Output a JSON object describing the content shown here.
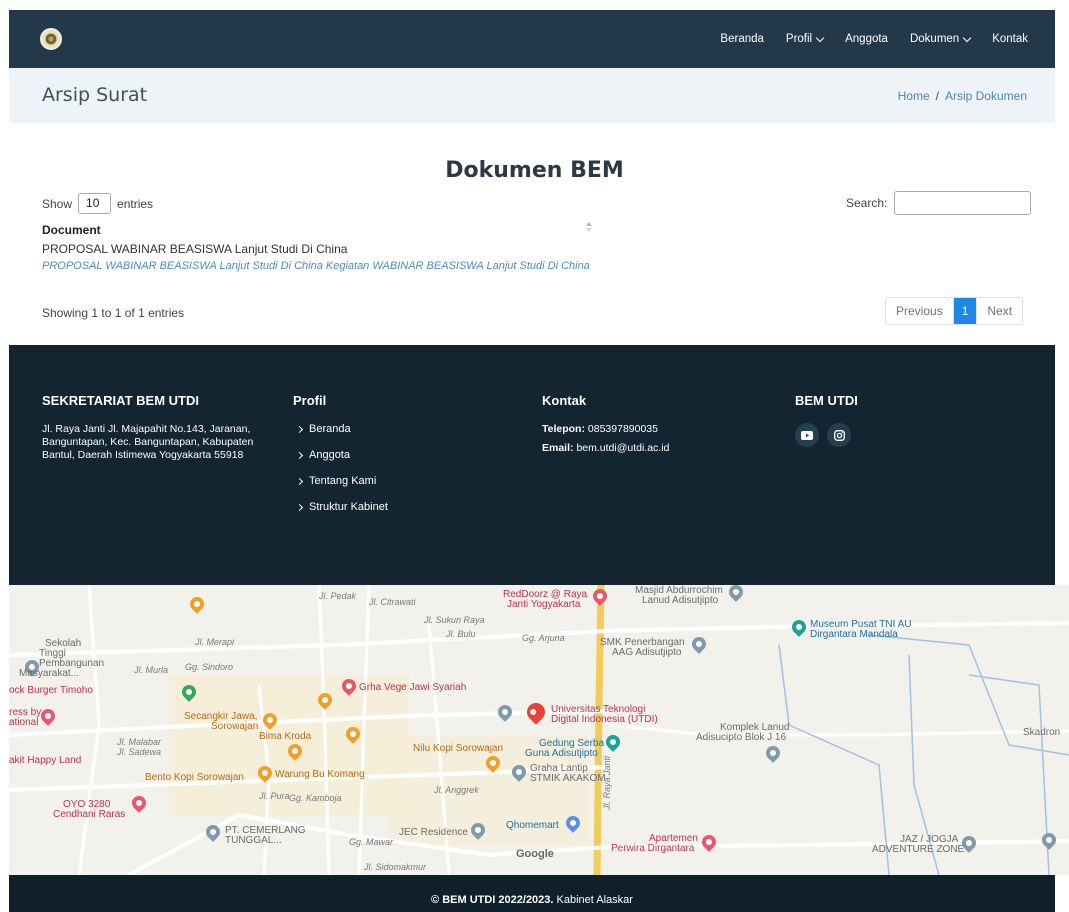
{
  "header": {
    "nav": [
      {
        "label": "Beranda",
        "dropdown": false
      },
      {
        "label": "Profil",
        "dropdown": true
      },
      {
        "label": "Anggota",
        "dropdown": false
      },
      {
        "label": "Dokumen",
        "dropdown": true
      },
      {
        "label": "Kontak",
        "dropdown": false
      }
    ]
  },
  "page": {
    "title": "Arsip Surat",
    "breadcrumb_home": "Home",
    "breadcrumb_sep": "/",
    "breadcrumb_current": "Arsip Dokumen"
  },
  "docs": {
    "heading": "Dokumen BEM",
    "show_label": "Show",
    "show_value": "10",
    "entries_label": "entries",
    "search_label": "Search:",
    "column_header": "Document",
    "rows": [
      {
        "title": "PROPOSAL WABINAR BEASISWA Lanjut Studi Di China",
        "description": "PROPOSAL WABINAR BEASISWA Lanjut Studi Di China Kegiatan WABINAR BEASISWA Lanjut Studi Di China"
      }
    ],
    "info": "Showing 1 to 1 of 1 entries",
    "pager": {
      "prev": "Previous",
      "page": "1",
      "next": "Next"
    }
  },
  "footer": {
    "sekretariat_title": "SEKRETARIAT BEM UTDI",
    "address": "Jl. Raya Janti Jl. Majapahit No.143, Jaranan, Banguntapan, Kec. Banguntapan, Kabupaten Bantul, Daerah Istimewa Yogyakarta 55918",
    "profil_title": "Profil",
    "profil_links": [
      "Beranda",
      "Anggota",
      "Tentang Kami",
      "Struktur Kabinet"
    ],
    "kontak_title": "Kontak",
    "telepon_label": "Telepon:",
    "telepon_value": "085397890035",
    "email_label": "Email:",
    "email_value": "bem.utdi@utdi.ac.id",
    "social_title": "BEM UTDI",
    "social_icons": [
      "youtube-icon",
      "instagram-icon"
    ]
  },
  "map": {
    "places": [
      "RedDoorz @ Raya",
      "Janti Yogyakarta",
      "Masjid Abdurrochim",
      "Lanud Adisutjipto",
      "Museum Pusat TNI AU",
      "Dirgantara Mandala",
      "Sekolah",
      "Tinggi",
      "Pembangunan",
      "Masyarakat...",
      "SMK Penerbangan",
      "AAG Adisutjipto",
      "Grha Vege Jawi Syariah",
      "ock Burger Timoho",
      "Universitas Teknologi",
      "Digital Indonesia (UTDI)",
      "Secangkir Jawa,",
      "Sorowajan",
      "ress by",
      "ational",
      "Bima Kroda",
      "Komplek Lanud",
      "Adisucipto Blok J 16",
      "Skadron",
      "Gedung Serba",
      "Guna Adisutjipto",
      "Nilu Kopi Sorowajan",
      "akit Happy Land",
      "Graha Lantip",
      "STMIK AKAKOM",
      "Bento Kopi Sorowajan",
      "Warung Bu Komang",
      "OYO 3280",
      "Cendhani Raras",
      "PT. CEMERLANG",
      "TUNGGAL...",
      "JEC Residence",
      "Qhomemart",
      "Apartemen",
      "Perwira Dirgantara",
      "JAZ / JOGJA",
      "ADVENTURE ZONE"
    ],
    "roads": [
      "Jl. Merapi",
      "Jl. Murla",
      "Gg. Sindoro",
      "Jl. Malabar",
      "Jl. Sadewa",
      "Gg. Kamboja",
      "Jl. Pura",
      "Gg. Mawar",
      "Jl. Sidomakmur",
      "Gg. Arjuna",
      "Jl. Bulu",
      "Jl. Raya Janti",
      "Jl. Pedak",
      "Jl. Citrawati",
      "Jl. Sukun Raya",
      "Jl. Anggrek"
    ],
    "google": "Google"
  },
  "copyright": {
    "bold": "© BEM UTDI 2022/2023.",
    "rest": " Kabinet Alaskar"
  }
}
